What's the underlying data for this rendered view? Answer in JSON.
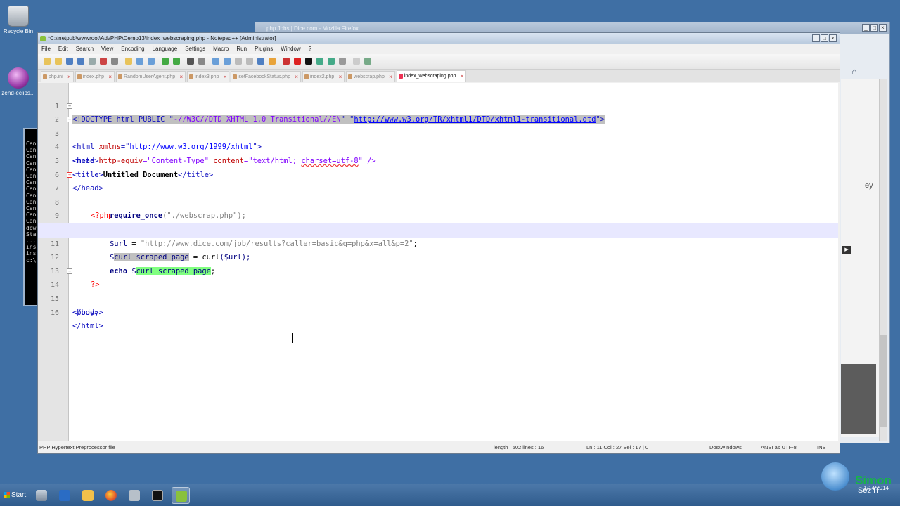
{
  "desktop": {
    "recycle_label": "Recycle Bin",
    "zend_label": "zend-eclips..."
  },
  "console": {
    "lines": [
      "Can",
      "Can",
      "Can",
      "Can",
      "Can",
      "Can",
      "Can",
      "Can",
      "Can",
      "Can",
      "Can",
      "Can",
      "Can",
      "dow",
      "Sta",
      "...",
      "ins",
      "ins",
      "c:\\"
    ]
  },
  "firefox": {
    "title": "php Jobs | Dice.com - Mozilla Firefox",
    "side_text": "ey"
  },
  "npp": {
    "title": "*C:\\inetpub\\wwwroot\\AdvPHP\\Demo13\\index_webscraping.php - Notepad++ [Administrator]",
    "menu": [
      "File",
      "Edit",
      "Search",
      "View",
      "Encoding",
      "Language",
      "Settings",
      "Macro",
      "Run",
      "Plugins",
      "Window",
      "?"
    ],
    "tabs": [
      "php.ini",
      "index.php",
      "RandomUserAgent.php",
      "index3.php",
      "setFacebookStatus.php",
      "index2.php",
      "webscrap.php",
      "index_webscraping.php"
    ],
    "active_tab": "index_webscraping.php",
    "line_numbers": [
      "1",
      "2",
      "3",
      "4",
      "5",
      "6",
      "7",
      "8",
      "9",
      "10",
      "11",
      "12",
      "13",
      "14",
      "15",
      "16"
    ],
    "code": {
      "l1a": "<!DOCTYPE html PUBLIC \"",
      "l1b": "-//W3C//DTD XHTML 1.0 Transitional//EN",
      "l1c": "\" \"",
      "l1d": "http://www.w3.org/TR/xhtml1/DTD/xhtml1-transitional.dtd",
      "l1e": "\">",
      "l2a": "<html ",
      "l2b": "xmlns",
      "l2c": "=\"",
      "l2d": "http://www.w3.org/1999/xhtml",
      "l2e": "\">",
      "l3": "<head>",
      "l4a": "<meta ",
      "l4b": "http-equiv",
      "l4c": "=\"Content-Type\" ",
      "l4d": "content",
      "l4e": "=\"text/html; ",
      "l4f": "charset=utf-8",
      "l4g": "\" />",
      "l5a": "<title>",
      "l5b": "Untitled Document",
      "l5c": "</title>",
      "l6": "</head>",
      "l7": "<?php",
      "l8a": "require_once",
      "l8b": "(\"./webscrap.php\");",
      "l10a": "$url",
      "l10b": " = ",
      "l10c": "\"http://www.dice.com/job/results?caller=basic&q=php&x=all&p=2\"",
      "l10d": ";",
      "l11a": "$",
      "l11b": "curl_scraped_page",
      "l11c": " = ",
      "l11d": "curl",
      "l11e": "($url);",
      "l12a": "echo ",
      "l12b": "$",
      "l12c": "curl_scraped_page",
      "l12d": ";",
      "l13": "?>",
      "l14": "<body>",
      "l15": "</body>",
      "l16": "</html>"
    },
    "status": {
      "filetype": "PHP Hypertext Preprocessor file",
      "length": "length : 502    lines : 16",
      "position": "Ln : 11    Col : 27    Sel : 17 | 0",
      "eol": "Dos\\Windows",
      "encoding": "ANSI as UTF-8",
      "mode": "INS"
    }
  },
  "taskbar": {
    "start_label": "Start",
    "clock_date": "1/14/2014"
  },
  "brand": {
    "name": "Simon",
    "sub": "Sez IT"
  },
  "colors": {
    "desktop": "#3f6fa4",
    "selection": "#c0c0c0",
    "smart_highlight": "#80ff80",
    "current_line": "#e8e8ff"
  }
}
